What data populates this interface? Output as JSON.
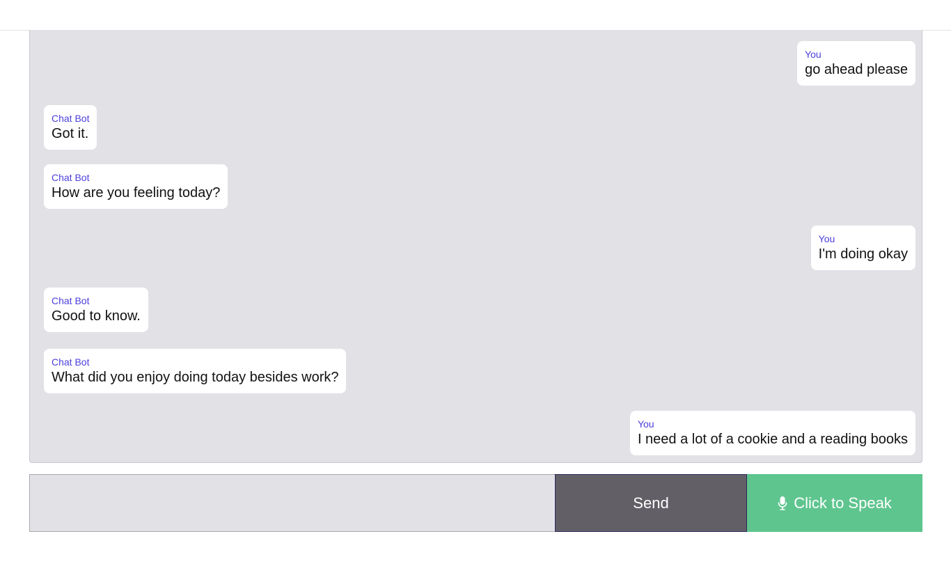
{
  "messages": [
    {
      "sender": "You",
      "text": "go ahead please"
    },
    {
      "sender": "Chat Bot",
      "text": "Got it."
    },
    {
      "sender": "Chat Bot",
      "text": "How are you feeling today?"
    },
    {
      "sender": "You",
      "text": "I'm doing okay"
    },
    {
      "sender": "Chat Bot",
      "text": "Good to know."
    },
    {
      "sender": "Chat Bot",
      "text": "What did you enjoy doing today besides work?"
    },
    {
      "sender": "You",
      "text": "I need a lot of a cookie and a reading books"
    }
  ],
  "composer": {
    "input_value": "",
    "send_label": "Send",
    "speak_label": "Click to Speak",
    "speak_icon": "microphone-icon"
  },
  "colors": {
    "chat_background": "#e2e1e6",
    "sender_name": "#4a3fdc",
    "send_button": "#625f66",
    "speak_button": "#5ec58e"
  }
}
